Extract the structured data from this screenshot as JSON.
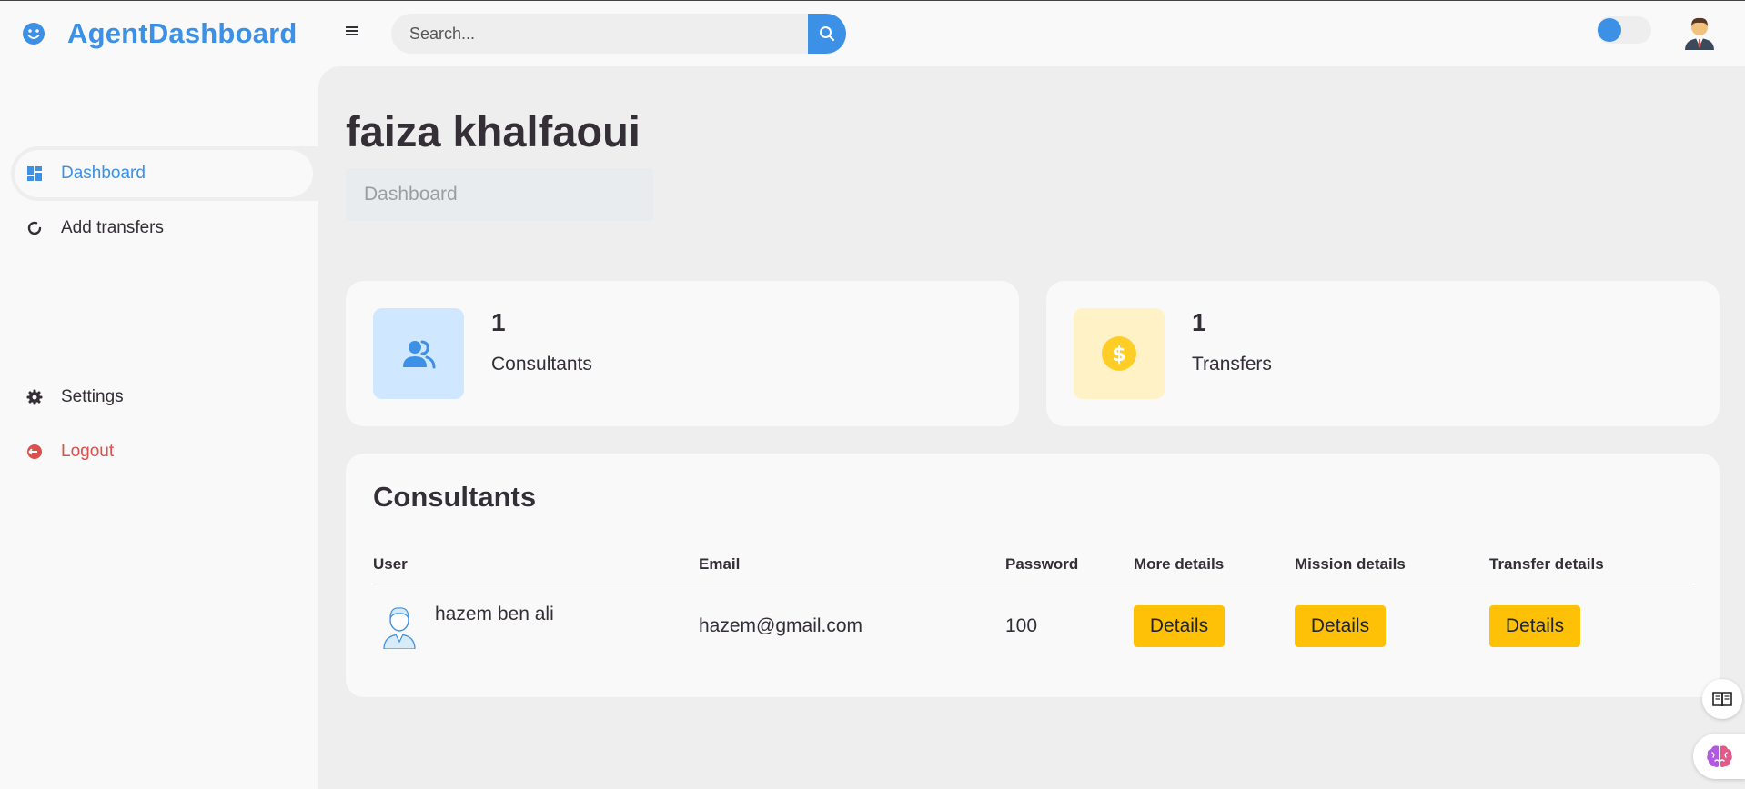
{
  "header": {
    "brand": "AgentDashboard",
    "search_placeholder": "Search..."
  },
  "sidebar": {
    "items": [
      {
        "label": "Dashboard",
        "icon": "dashboard-icon",
        "active": true
      },
      {
        "label": "Add transfers",
        "icon": "refresh-icon",
        "active": false
      }
    ],
    "bottom_items": [
      {
        "label": "Settings",
        "icon": "gear-icon"
      },
      {
        "label": "Logout",
        "icon": "logout-icon"
      }
    ]
  },
  "main": {
    "title": "faiza khalfaoui",
    "breadcrumb": "Dashboard",
    "stats": [
      {
        "value": "1",
        "label": "Consultants",
        "icon": "group-icon",
        "color": "#3c91e6"
      },
      {
        "value": "1",
        "label": "Transfers",
        "icon": "dollar-icon",
        "color": "#ffce26"
      }
    ],
    "table": {
      "title": "Consultants",
      "columns": [
        "User",
        "Email",
        "Password",
        "More details",
        "Mission details",
        "Transfer details"
      ],
      "rows": [
        {
          "user": "hazem ben ali",
          "email": "hazem@gmail.com",
          "password": "100",
          "more": "Details",
          "mission": "Details",
          "transfer": "Details"
        }
      ]
    }
  },
  "colors": {
    "accent": "#3c91e6",
    "danger": "#db504a",
    "button": "#ffc107",
    "content_bg": "#eeeeee",
    "card_bg": "#f9f9f9"
  }
}
